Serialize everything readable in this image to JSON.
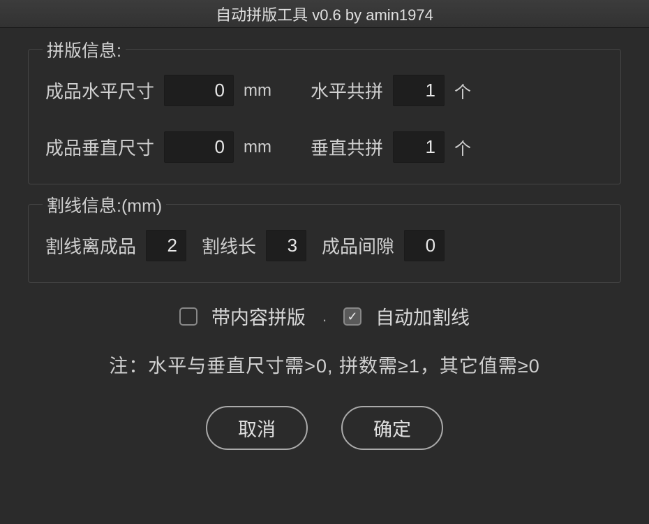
{
  "window": {
    "title": "自动拼版工具 v0.6   by amin1974"
  },
  "group_imposition": {
    "legend": "拼版信息:",
    "horizontal_size_label": "成品水平尺寸",
    "horizontal_size_value": "0",
    "horizontal_size_unit": "mm",
    "horizontal_count_label": "水平共拼",
    "horizontal_count_value": "1",
    "horizontal_count_unit": "个",
    "vertical_size_label": "成品垂直尺寸",
    "vertical_size_value": "0",
    "vertical_size_unit": "mm",
    "vertical_count_label": "垂直共拼",
    "vertical_count_value": "1",
    "vertical_count_unit": "个"
  },
  "group_cutline": {
    "legend": "割线信息:(mm)",
    "offset_label": "割线离成品",
    "offset_value": "2",
    "length_label": "割线长",
    "length_value": "3",
    "gap_label": "成品间隙",
    "gap_value": "0"
  },
  "options": {
    "with_content_label": "带内容拼版",
    "with_content_checked": false,
    "auto_cutline_label": "自动加割线",
    "auto_cutline_checked": true
  },
  "note": "注：水平与垂直尺寸需>0, 拼数需≥1，其它值需≥0",
  "buttons": {
    "cancel": "取消",
    "ok": "确定"
  }
}
